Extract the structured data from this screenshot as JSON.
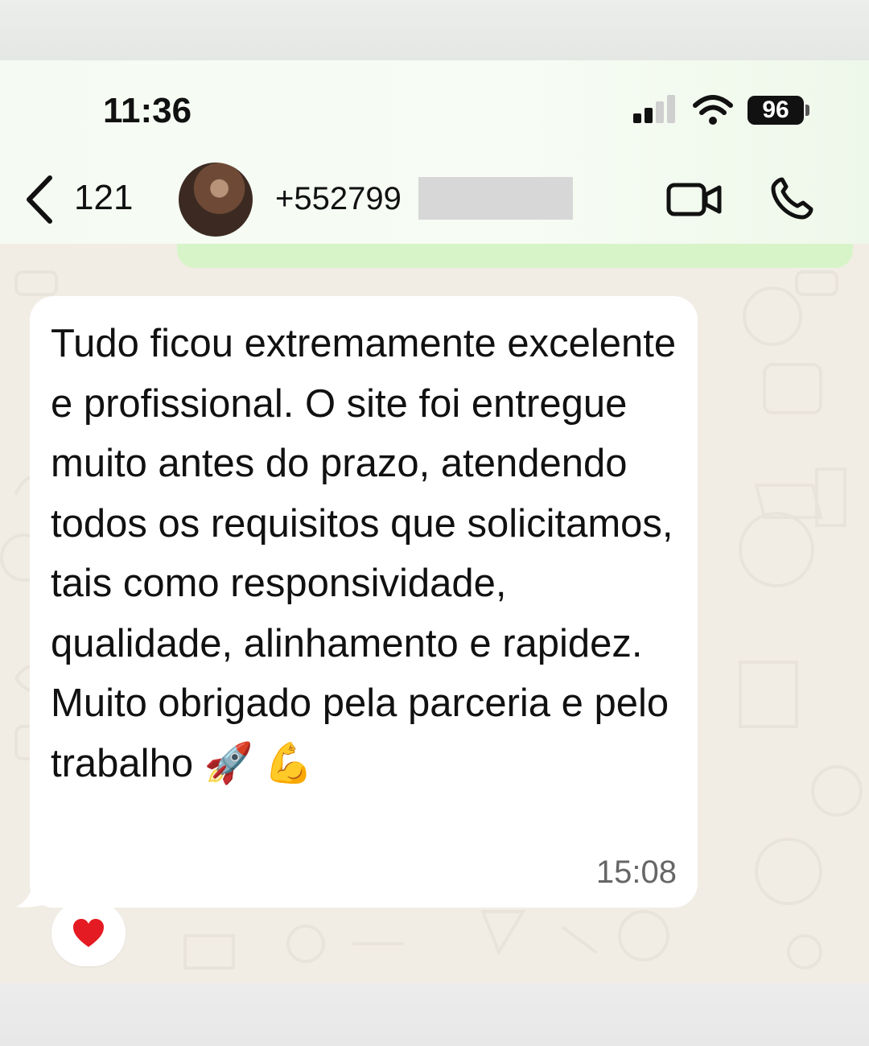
{
  "status_bar": {
    "time": "11:36",
    "battery": "96"
  },
  "header": {
    "back_count": "121",
    "contact_name": "+552799"
  },
  "chat": {
    "message": {
      "text": "Tudo ficou extremamente excelente e profissional. O site foi entregue muito antes do prazo, atendendo todos os requisitos que solicitamos, tais como responsividade, qualidade, alinhamento e rapidez. Muito obrigado pela parceria e pelo trabalho",
      "emoji_1": "🚀",
      "emoji_2": "💪",
      "time": "15:08"
    },
    "reaction": "heart-icon"
  },
  "colors": {
    "header_bg": "#f5fbf3",
    "chat_bg": "#f1ede5",
    "sent_bubble": "#d7f4c8",
    "received_bubble": "#ffffff",
    "read_ticks": "#4f9cf0"
  }
}
